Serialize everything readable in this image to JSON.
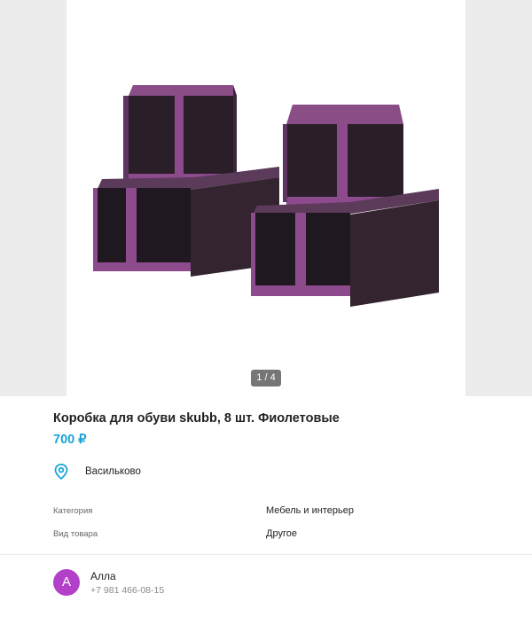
{
  "gallery": {
    "image_alt": "Коробка для обуви skubb",
    "counter": "1 / 4"
  },
  "listing": {
    "title": "Коробка для обуви skubb, 8 шт. Фиолетовые",
    "price": "700 ₽",
    "location": "Васильково",
    "location_icon": "map-pin-icon",
    "accent_color": "#1aa3d9"
  },
  "properties": [
    {
      "key": "Категория",
      "value": "Мебель и интерьер"
    },
    {
      "key": "Вид товара",
      "value": "Другое"
    }
  ],
  "seller": {
    "initial": "А",
    "name": "Алла",
    "phone": "+7 981 466-08-15",
    "avatar_color": "#b340c9"
  }
}
